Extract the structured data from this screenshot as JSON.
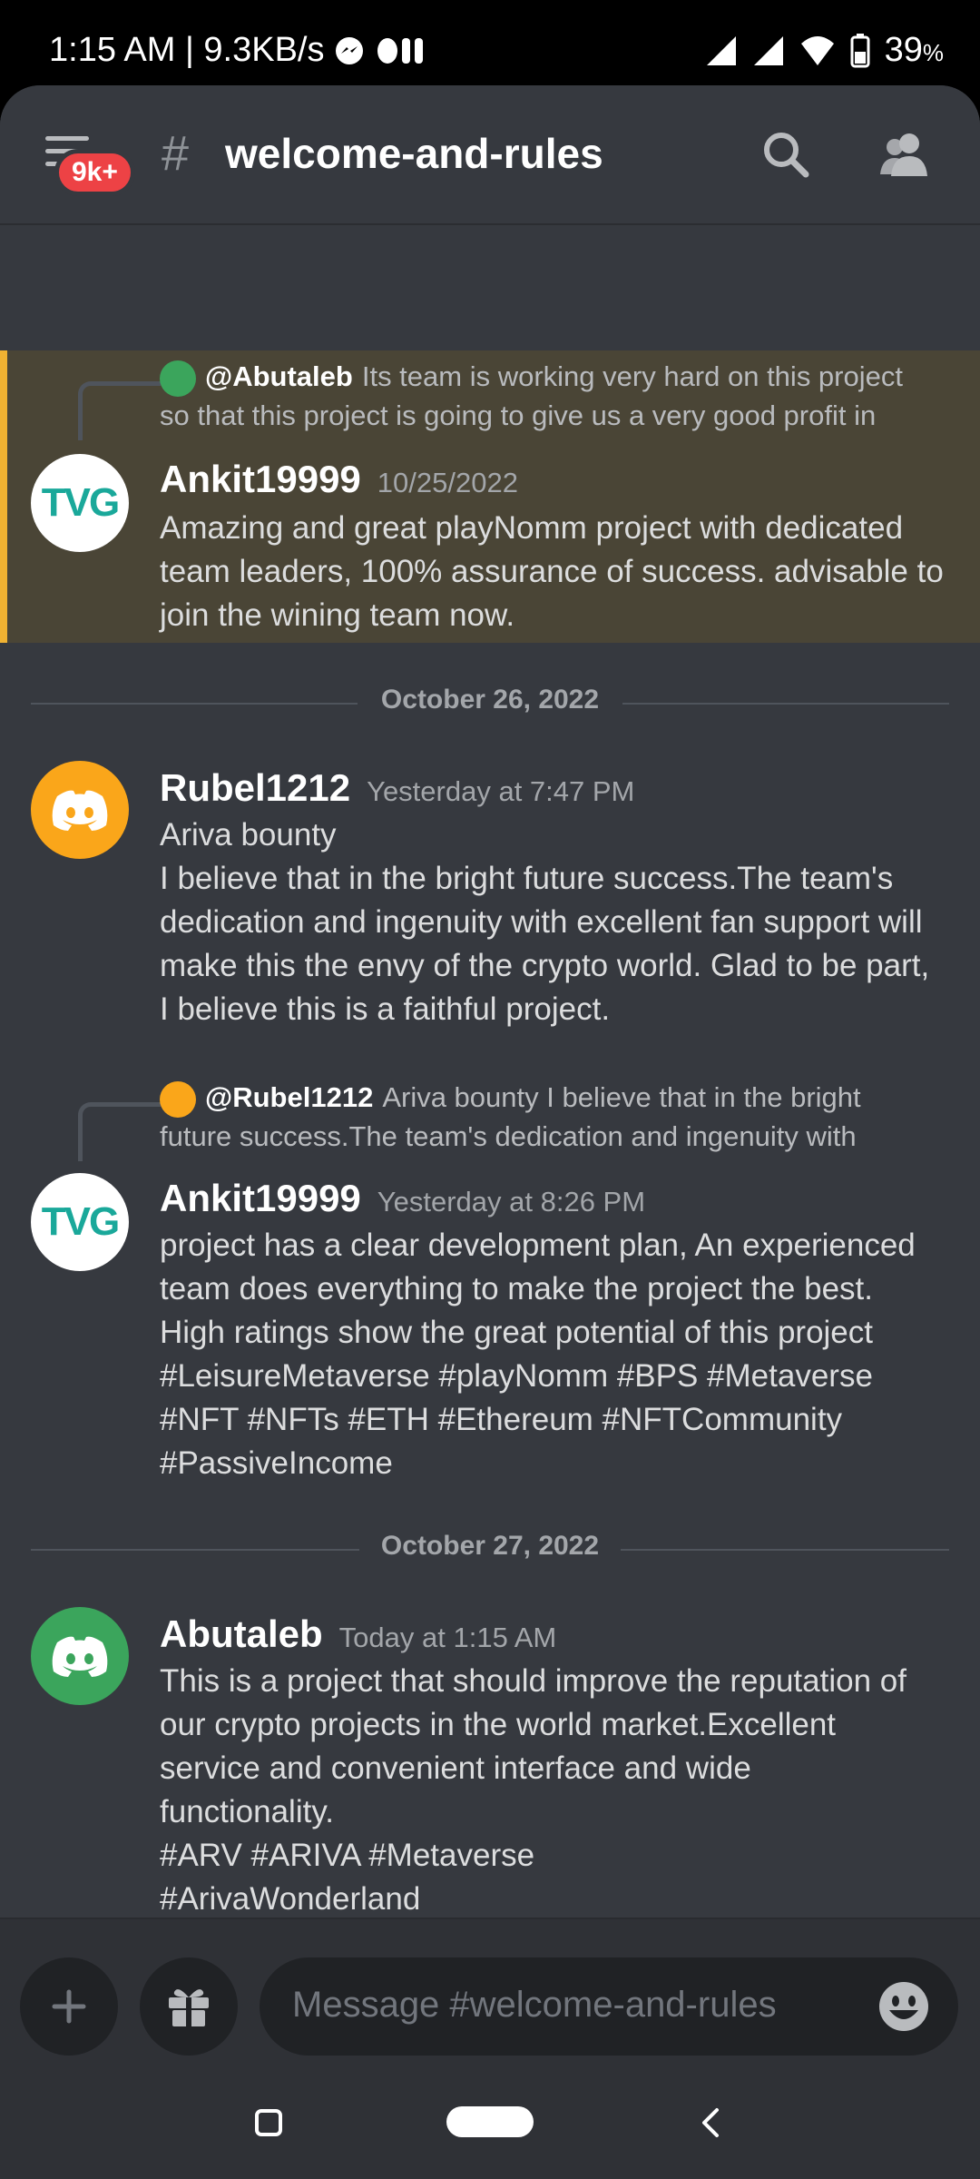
{
  "status_bar": {
    "time_speed": "1:15 AM | 9.3KB/s",
    "battery": "39",
    "battery_unit": "%"
  },
  "header": {
    "badge": "9k+",
    "hash": "#",
    "channel_name": "welcome-and-rules"
  },
  "messages": [
    {
      "reply_to": "@Abutaleb",
      "reply_preview_1": "Its team is working very hard on this project",
      "reply_preview_2": "so that this project is going to give us a very good profit in",
      "author": "Ankit19999",
      "timestamp": "10/25/2022",
      "text": [
        "Amazing and great playNomm  project with dedicated",
        "team leaders, 100% assurance of success. advisable to",
        "join the wining team now."
      ]
    },
    {
      "author": "Rubel1212",
      "timestamp": "Yesterday at 7:47 PM",
      "text": [
        "Ariva bounty",
        "I believe that in the bright future success.The team's",
        "dedication and ingenuity with excellent fan support will",
        "make this the envy of the crypto world. Glad to be part,",
        "I believe this is a faithful project."
      ]
    },
    {
      "reply_to": "@Rubel1212",
      "reply_preview_1": "Ariva bounty  I believe that in the bright",
      "reply_preview_2": "future success.The team's dedication and ingenuity with",
      "author": "Ankit19999",
      "timestamp": "Yesterday at 8:26 PM",
      "text": [
        "project has a clear development plan, An experienced",
        "team does everything to make the project the best.",
        "High ratings show the great potential of this project",
        "#LeisureMetaverse #playNomm #BPS #Metaverse",
        "#NFT #NFTs #ETH #Ethereum #NFTCommunity",
        "#PassiveIncome"
      ]
    },
    {
      "author": "Abutaleb",
      "timestamp": "Today at 1:15 AM",
      "text": [
        "This is a project that should improve the reputation of",
        "our crypto projects in the world market.Excellent",
        "service and convenient interface and wide",
        "functionality.",
        "#ARV #ARIVA #Metaverse",
        "#ArivaWonderland"
      ]
    }
  ],
  "dividers": [
    "October 26, 2022",
    "October 27, 2022"
  ],
  "avatar_text": "TVG",
  "composer": {
    "placeholder": "Message #welcome-and-rules"
  },
  "colors": {
    "background": "#36393f",
    "highlight": "#4a4536",
    "highlight_bar": "#f0b232",
    "badge": "#ed4245",
    "discord_orange": "#faa61a",
    "discord_green": "#3ba55c",
    "tvg_teal": "#1aa89a"
  },
  "icons": [
    "hamburger-icon",
    "search-icon",
    "members-icon",
    "plus-icon",
    "gift-icon",
    "emoji-icon",
    "discord-icon",
    "recent-apps-icon",
    "home-pill-icon",
    "back-icon"
  ]
}
